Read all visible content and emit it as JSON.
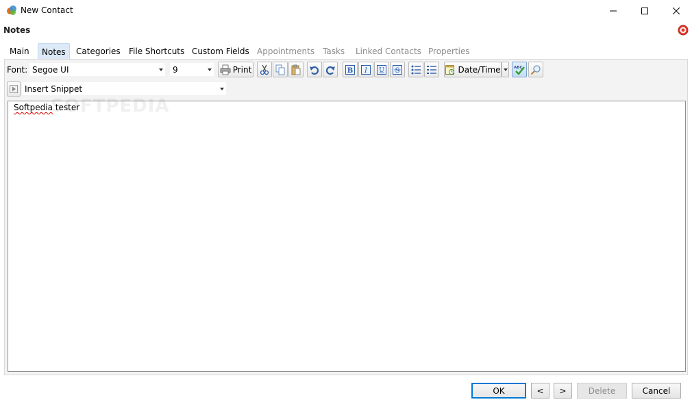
{
  "window": {
    "title": "New Contact"
  },
  "section": {
    "title": "Notes"
  },
  "tabs": [
    {
      "label": "Main",
      "state": "normal"
    },
    {
      "label": "Notes",
      "state": "active"
    },
    {
      "label": "Categories",
      "state": "normal"
    },
    {
      "label": "File Shortcuts",
      "state": "normal"
    },
    {
      "label": "Custom Fields",
      "state": "normal"
    },
    {
      "label": "Appointments",
      "state": "disabled"
    },
    {
      "label": "Tasks",
      "state": "disabled"
    },
    {
      "label": "Linked Contacts",
      "state": "disabled"
    },
    {
      "label": "Properties",
      "state": "disabled"
    }
  ],
  "toolbar": {
    "font_label": "Font:",
    "font_value": "Segoe UI",
    "size_value": "9",
    "print_label": "Print",
    "datetime_label": "Date/Time",
    "spell_badge": "ABC"
  },
  "snippet": {
    "value": "Insert Snippet"
  },
  "editor": {
    "text": "Softpedia tester",
    "watermark": "SOFTPEDIA"
  },
  "buttons": {
    "ok": "OK",
    "prev": "<",
    "next": ">",
    "delete": "Delete",
    "cancel": "Cancel"
  },
  "colors": {
    "accent": "#0078d7",
    "active_tab": "#dce9f7",
    "panel_bg": "#f3f3f3"
  }
}
